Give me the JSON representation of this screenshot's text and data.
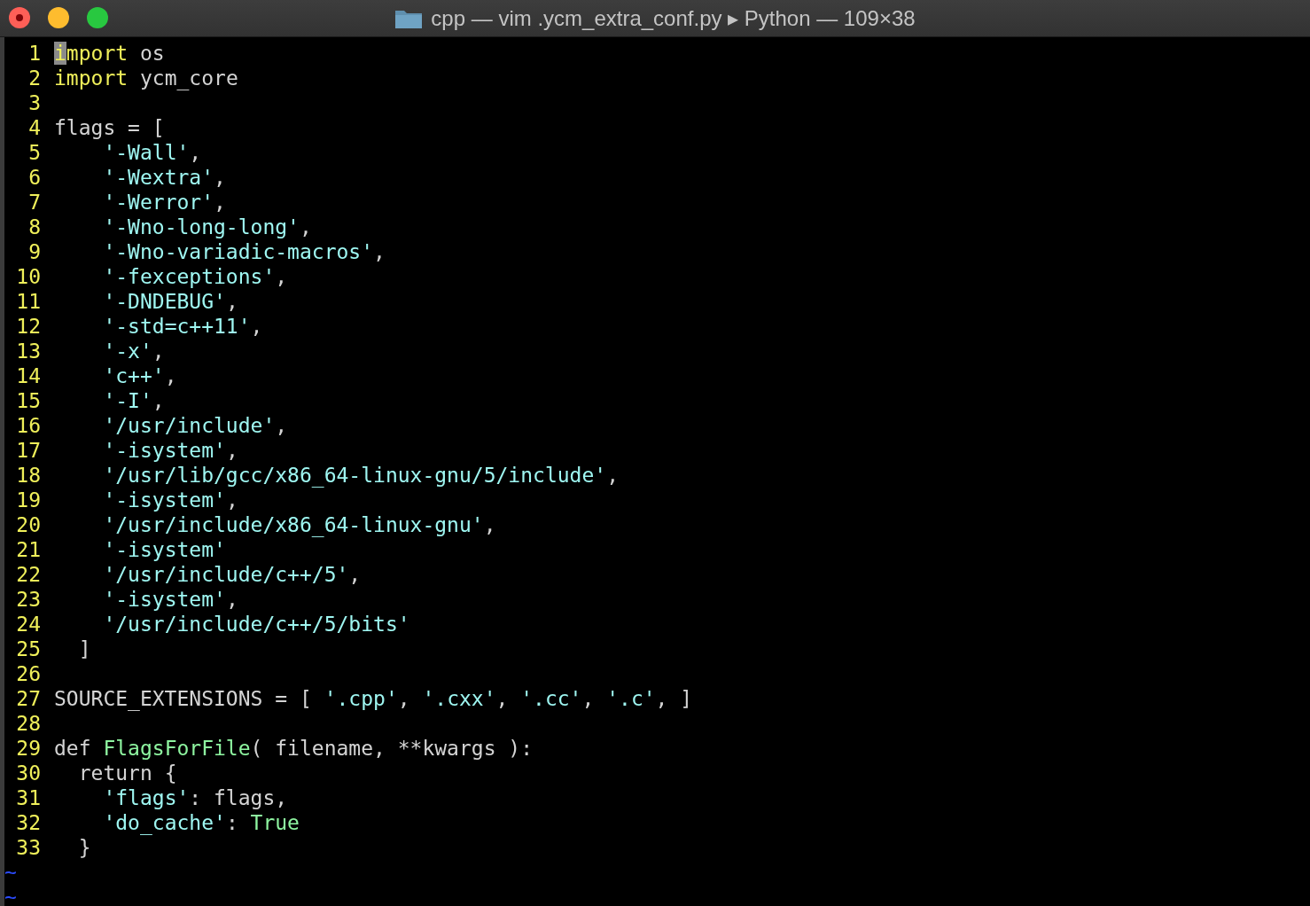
{
  "window": {
    "title": "cpp — vim .ycm_extra_conf.py ▸ Python — 109×38"
  },
  "editor": {
    "lines": [
      {
        "number": "1",
        "tokens": [
          {
            "kind": "cursor",
            "text": "i"
          },
          {
            "kind": "keyword",
            "text": "mport"
          },
          {
            "kind": "plain",
            "text": " os"
          }
        ]
      },
      {
        "number": "2",
        "tokens": [
          {
            "kind": "keyword",
            "text": "import"
          },
          {
            "kind": "plain",
            "text": " ycm_core"
          }
        ]
      },
      {
        "number": "3"
      },
      {
        "number": "4",
        "tokens": [
          {
            "kind": "plain",
            "text": "flags = ["
          }
        ]
      },
      {
        "number": "5",
        "tokens": [
          {
            "kind": "string",
            "text": "    '-Wall'"
          },
          {
            "kind": "plain",
            "text": ","
          }
        ]
      },
      {
        "number": "6",
        "tokens": [
          {
            "kind": "string",
            "text": "    '-Wextra'"
          },
          {
            "kind": "plain",
            "text": ","
          }
        ]
      },
      {
        "number": "7",
        "tokens": [
          {
            "kind": "string",
            "text": "    '-Werror'"
          },
          {
            "kind": "plain",
            "text": ","
          }
        ]
      },
      {
        "number": "8",
        "tokens": [
          {
            "kind": "string",
            "text": "    '-Wno-long-long'"
          },
          {
            "kind": "plain",
            "text": ","
          }
        ]
      },
      {
        "number": "9",
        "tokens": [
          {
            "kind": "string",
            "text": "    '-Wno-variadic-macros'"
          },
          {
            "kind": "plain",
            "text": ","
          }
        ]
      },
      {
        "number": "10",
        "tokens": [
          {
            "kind": "string",
            "text": "    '-fexceptions'"
          },
          {
            "kind": "plain",
            "text": ","
          }
        ]
      },
      {
        "number": "11",
        "tokens": [
          {
            "kind": "string",
            "text": "    '-DNDEBUG'"
          },
          {
            "kind": "plain",
            "text": ","
          }
        ]
      },
      {
        "number": "12",
        "tokens": [
          {
            "kind": "string",
            "text": "    '-std=c++11'"
          },
          {
            "kind": "plain",
            "text": ","
          }
        ]
      },
      {
        "number": "13",
        "tokens": [
          {
            "kind": "string",
            "text": "    '-x'"
          },
          {
            "kind": "plain",
            "text": ","
          }
        ]
      },
      {
        "number": "14",
        "tokens": [
          {
            "kind": "string",
            "text": "    'c++'"
          },
          {
            "kind": "plain",
            "text": ","
          }
        ]
      },
      {
        "number": "15",
        "tokens": [
          {
            "kind": "string",
            "text": "    '-I'"
          },
          {
            "kind": "plain",
            "text": ","
          }
        ]
      },
      {
        "number": "16",
        "tokens": [
          {
            "kind": "string",
            "text": "    '/usr/include'"
          },
          {
            "kind": "plain",
            "text": ","
          }
        ]
      },
      {
        "number": "17",
        "tokens": [
          {
            "kind": "string",
            "text": "    '-isystem'"
          },
          {
            "kind": "plain",
            "text": ","
          }
        ]
      },
      {
        "number": "18",
        "tokens": [
          {
            "kind": "string",
            "text": "    '/usr/lib/gcc/x86_64-linux-gnu/5/include'"
          },
          {
            "kind": "plain",
            "text": ","
          }
        ]
      },
      {
        "number": "19",
        "tokens": [
          {
            "kind": "string",
            "text": "    '-isystem'"
          },
          {
            "kind": "plain",
            "text": ","
          }
        ]
      },
      {
        "number": "20",
        "tokens": [
          {
            "kind": "string",
            "text": "    '/usr/include/x86_64-linux-gnu'"
          },
          {
            "kind": "plain",
            "text": ","
          }
        ]
      },
      {
        "number": "21",
        "tokens": [
          {
            "kind": "string",
            "text": "    '-isystem'"
          }
        ]
      },
      {
        "number": "22",
        "tokens": [
          {
            "kind": "string",
            "text": "    '/usr/include/c++/5'"
          },
          {
            "kind": "plain",
            "text": ","
          }
        ]
      },
      {
        "number": "23",
        "tokens": [
          {
            "kind": "string",
            "text": "    '-isystem'"
          },
          {
            "kind": "plain",
            "text": ","
          }
        ]
      },
      {
        "number": "24",
        "tokens": [
          {
            "kind": "string",
            "text": "    '/usr/include/c++/5/bits'"
          }
        ]
      },
      {
        "number": "25",
        "tokens": [
          {
            "kind": "plain",
            "text": "  ]"
          }
        ]
      },
      {
        "number": "26"
      },
      {
        "number": "27",
        "tokens": [
          {
            "kind": "plain",
            "text": "SOURCE_EXTENSIONS = [ "
          },
          {
            "kind": "string",
            "text": "'.cpp'"
          },
          {
            "kind": "plain",
            "text": ", "
          },
          {
            "kind": "string",
            "text": "'.cxx'"
          },
          {
            "kind": "plain",
            "text": ", "
          },
          {
            "kind": "string",
            "text": "'.cc'"
          },
          {
            "kind": "plain",
            "text": ", "
          },
          {
            "kind": "string",
            "text": "'.c'"
          },
          {
            "kind": "plain",
            "text": ", ]"
          }
        ]
      },
      {
        "number": "28"
      },
      {
        "number": "29",
        "tokens": [
          {
            "kind": "plain",
            "text": "def "
          },
          {
            "kind": "function",
            "text": "FlagsForFile"
          },
          {
            "kind": "plain",
            "text": "( filename, **kwargs ):"
          }
        ]
      },
      {
        "number": "30",
        "tokens": [
          {
            "kind": "plain",
            "text": "  return {"
          }
        ]
      },
      {
        "number": "31",
        "tokens": [
          {
            "kind": "string",
            "text": "    'flags'"
          },
          {
            "kind": "plain",
            "text": ": flags,"
          }
        ]
      },
      {
        "number": "32",
        "tokens": [
          {
            "kind": "string",
            "text": "    'do_cache'"
          },
          {
            "kind": "plain",
            "text": ": "
          },
          {
            "kind": "constant",
            "text": "True"
          }
        ]
      },
      {
        "number": "33",
        "tokens": [
          {
            "kind": "plain",
            "text": "  }"
          }
        ]
      }
    ],
    "empty_markers": [
      "~",
      "~"
    ]
  }
}
